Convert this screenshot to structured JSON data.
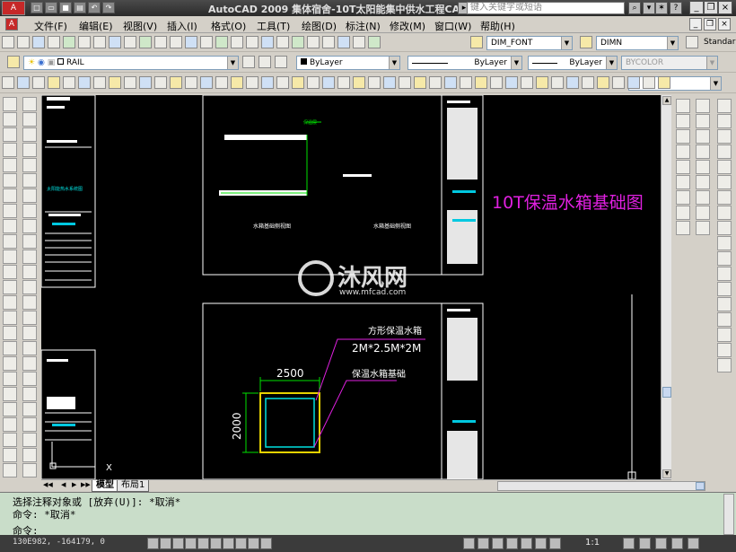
{
  "titlebar": {
    "app_label": "A",
    "title": "AutoCAD 2009  集体宿舍-10T太阳能集中供水工程CAD套图",
    "search_placeholder": "键入关键字或短语"
  },
  "menu": [
    "文件(F)",
    "编辑(E)",
    "视图(V)",
    "插入(I)",
    "格式(O)",
    "工具(T)",
    "绘图(D)",
    "标注(N)",
    "修改(M)",
    "窗口(W)",
    "帮助(H)"
  ],
  "toolbar1": {
    "text_style": "DIM_FONT",
    "dim_style": "DIMN",
    "table_style": "Standar"
  },
  "toolbar2": {
    "layer": "RAIL",
    "color": "ByLayer",
    "linetype": "ByLayer",
    "lineweight": "ByLayer",
    "plotstyle": "BYCOLOR"
  },
  "drawing": {
    "upper_label_left": "水箱基础侧视图",
    "upper_label_right": "水箱基础侧视图",
    "upper_leader_note": "保温层",
    "big_title": "10T保温水箱基础图",
    "watermark_text": "沐风网",
    "watermark_url": "www.mfcad.com",
    "tank_label": "方形保温水箱",
    "tank_size": "2M*2.5M*2M",
    "base_label": "保温水箱基础",
    "dim_width": "2500",
    "dim_height": "2000",
    "left_sheet_title": "太阳能热水系统图",
    "axis_x": "X"
  },
  "layout_tabs": [
    "模型",
    "布局1"
  ],
  "command": {
    "line1": "选择注释对象或 [放弃(U)]: *取消*",
    "line2": "命令: *取消*",
    "line3": "命令:"
  },
  "status": {
    "coords": "130E982, -164179, 0",
    "scale": "1:1"
  }
}
